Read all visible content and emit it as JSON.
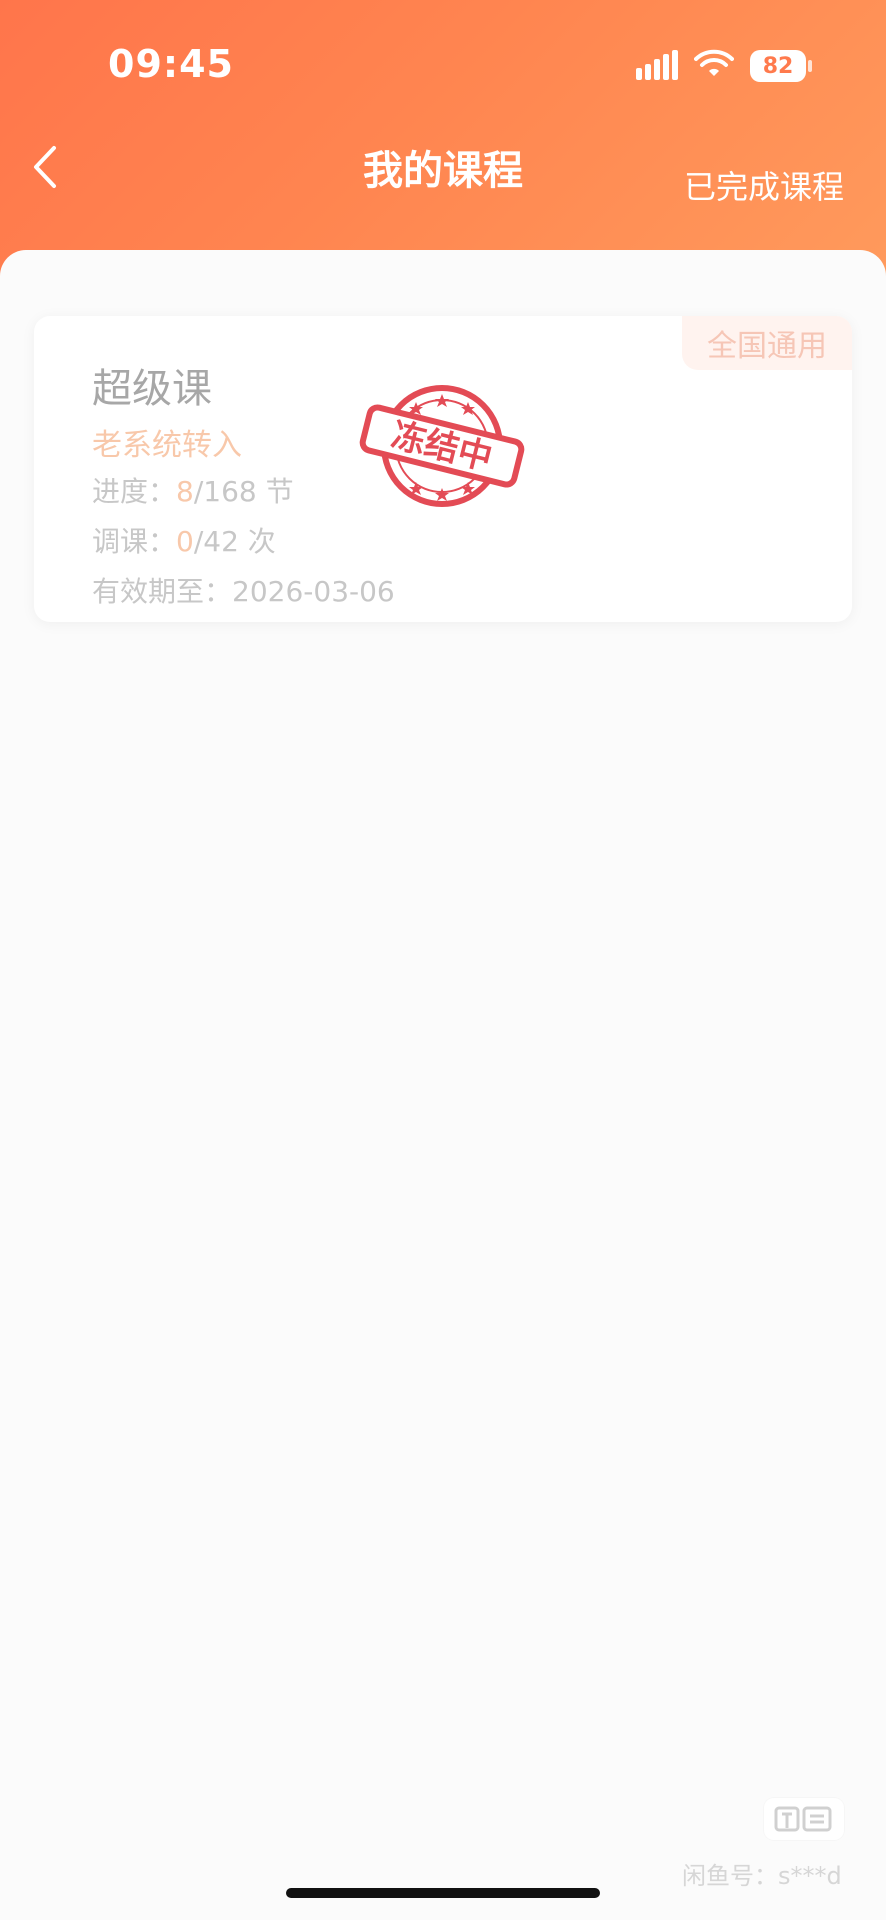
{
  "status_bar": {
    "time": "09:45",
    "battery": "82"
  },
  "header": {
    "title": "我的课程",
    "right_action": "已完成课程"
  },
  "course_card": {
    "tag": "全国通用",
    "name": "超级课",
    "source": "老系统转入",
    "progress": {
      "label": "进度：",
      "done": "8",
      "total": "/168 节"
    },
    "adjust": {
      "label": "调课：",
      "used": "0",
      "total": "/42 次"
    },
    "valid": {
      "label": "有效期至：",
      "date": "2026-03-06"
    },
    "stamp": "冻结中"
  },
  "watermark": {
    "text": "闲鱼号：s***d",
    "logo": "闲鱼"
  },
  "colors": {
    "header_start": "#ff754b",
    "header_end": "#ff9a5c",
    "accent_orange": "#f8c8aa",
    "stamp_red": "#e34b55"
  },
  "icons": {
    "back": "chevron-left-icon",
    "signal": "signal-bars-icon",
    "wifi": "wifi-icon",
    "battery": "battery-icon",
    "watermark_logo": "xianyu-logo-icon",
    "stamp": "frozen-stamp-icon"
  }
}
